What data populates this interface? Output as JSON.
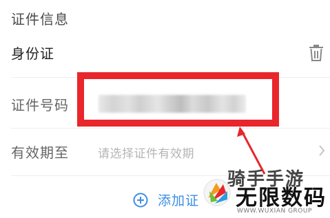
{
  "section": {
    "title": "证件信息"
  },
  "id_type": {
    "label": "身份证",
    "delete_icon": "trash-icon"
  },
  "id_number": {
    "label": "证件号码",
    "value_obscured": true,
    "highlight_color": "#e8262b"
  },
  "expiry": {
    "label": "有效期至",
    "placeholder": "请选择证件有效期",
    "chevron_icon": "chevron-right-icon"
  },
  "add": {
    "icon": "plus-circle-icon",
    "label": "添加证",
    "color": "#3a8ee6"
  },
  "watermark": {
    "line1": "骑手手游",
    "brand": "无限数码",
    "sub": "WWW.WUXIAN GROUP"
  }
}
